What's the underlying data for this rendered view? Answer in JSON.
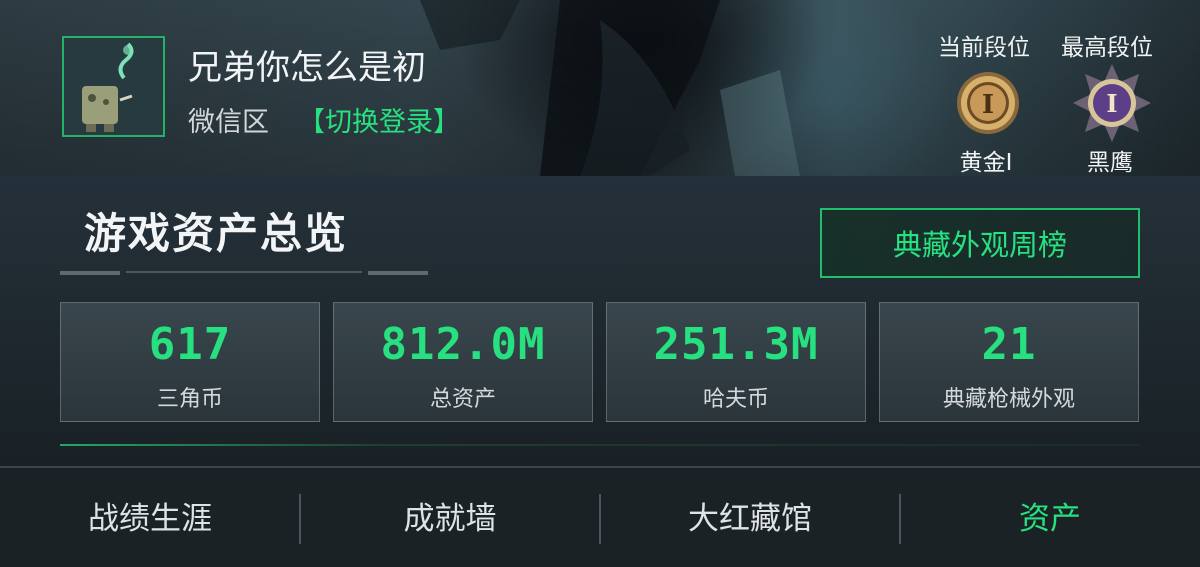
{
  "profile": {
    "username": "兄弟你怎么是初",
    "region": "微信区",
    "switch_login": "【切换登录】"
  },
  "ranks": {
    "current_title": "当前段位",
    "highest_title": "最高段位",
    "current_rank": "黄金I",
    "highest_rank": "黑鹰",
    "current_badge_numeral": "I",
    "highest_badge_numeral": "I"
  },
  "overview": {
    "title": "游戏资产总览",
    "weekly_button": "典藏外观周榜"
  },
  "stats": [
    {
      "value": "617",
      "label": "三角币"
    },
    {
      "value": "812.0M",
      "label": "总资产"
    },
    {
      "value": "251.3M",
      "label": "哈夫币"
    },
    {
      "value": "21",
      "label": "典藏枪械外观"
    }
  ],
  "tabs": [
    {
      "label": "战绩生涯",
      "active": false
    },
    {
      "label": "成就墙",
      "active": false
    },
    {
      "label": "大红藏馆",
      "active": false
    },
    {
      "label": "资产",
      "active": true
    }
  ],
  "colors": {
    "accent": "#27e07f",
    "background": "#1c2428"
  }
}
